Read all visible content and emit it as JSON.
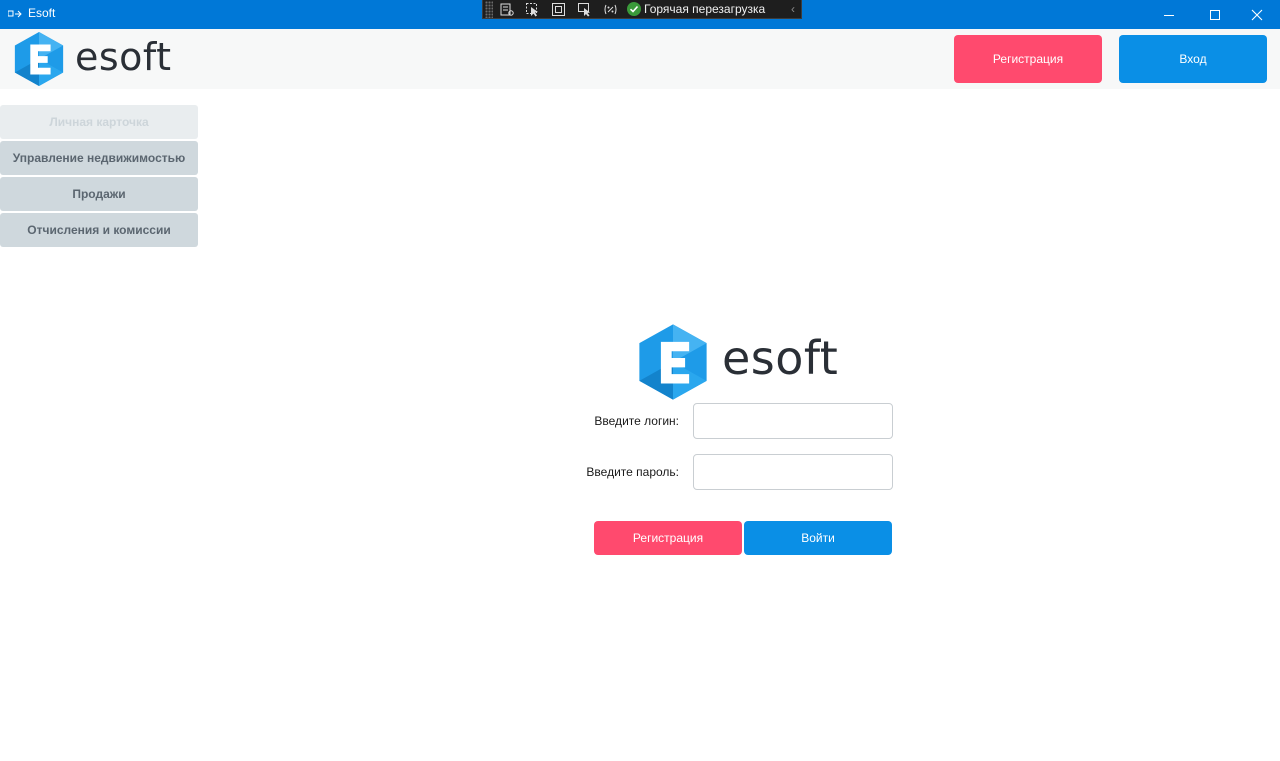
{
  "window": {
    "title": "Esoft",
    "icons": [
      "app-icon",
      "minimize-icon",
      "maximize-icon",
      "close-icon"
    ]
  },
  "debug_toolbar": {
    "hot_reload_label": "Горячая перезагрузка",
    "icons": [
      "live-visual-tree-icon",
      "select-element-icon",
      "display-adorners-icon",
      "track-focus-icon",
      "binding-failures-icon",
      "check-icon",
      "collapse-chevron-icon"
    ]
  },
  "header": {
    "logo_text": "esoft",
    "register_label": "Регистрация",
    "login_label": "Вход"
  },
  "sidebar": {
    "items": [
      {
        "label": "Личная карточка",
        "enabled": false
      },
      {
        "label": "Управление недвижимостью",
        "enabled": true
      },
      {
        "label": "Продажи",
        "enabled": true
      },
      {
        "label": "Отчисления и комиссии",
        "enabled": true
      }
    ]
  },
  "login_form": {
    "logo_text": "esoft",
    "login_label": "Введите логин:",
    "login_value": "",
    "password_label": "Введите пароль:",
    "password_value": "",
    "register_label": "Регистрация",
    "submit_label": "Войти"
  },
  "colors": {
    "titlebar": "#0078d7",
    "accent_pink": "#ff4a6e",
    "accent_blue": "#0a8fe6",
    "sidebar_item": "#cfd8dd",
    "logo_blue": "#1e9be8"
  }
}
